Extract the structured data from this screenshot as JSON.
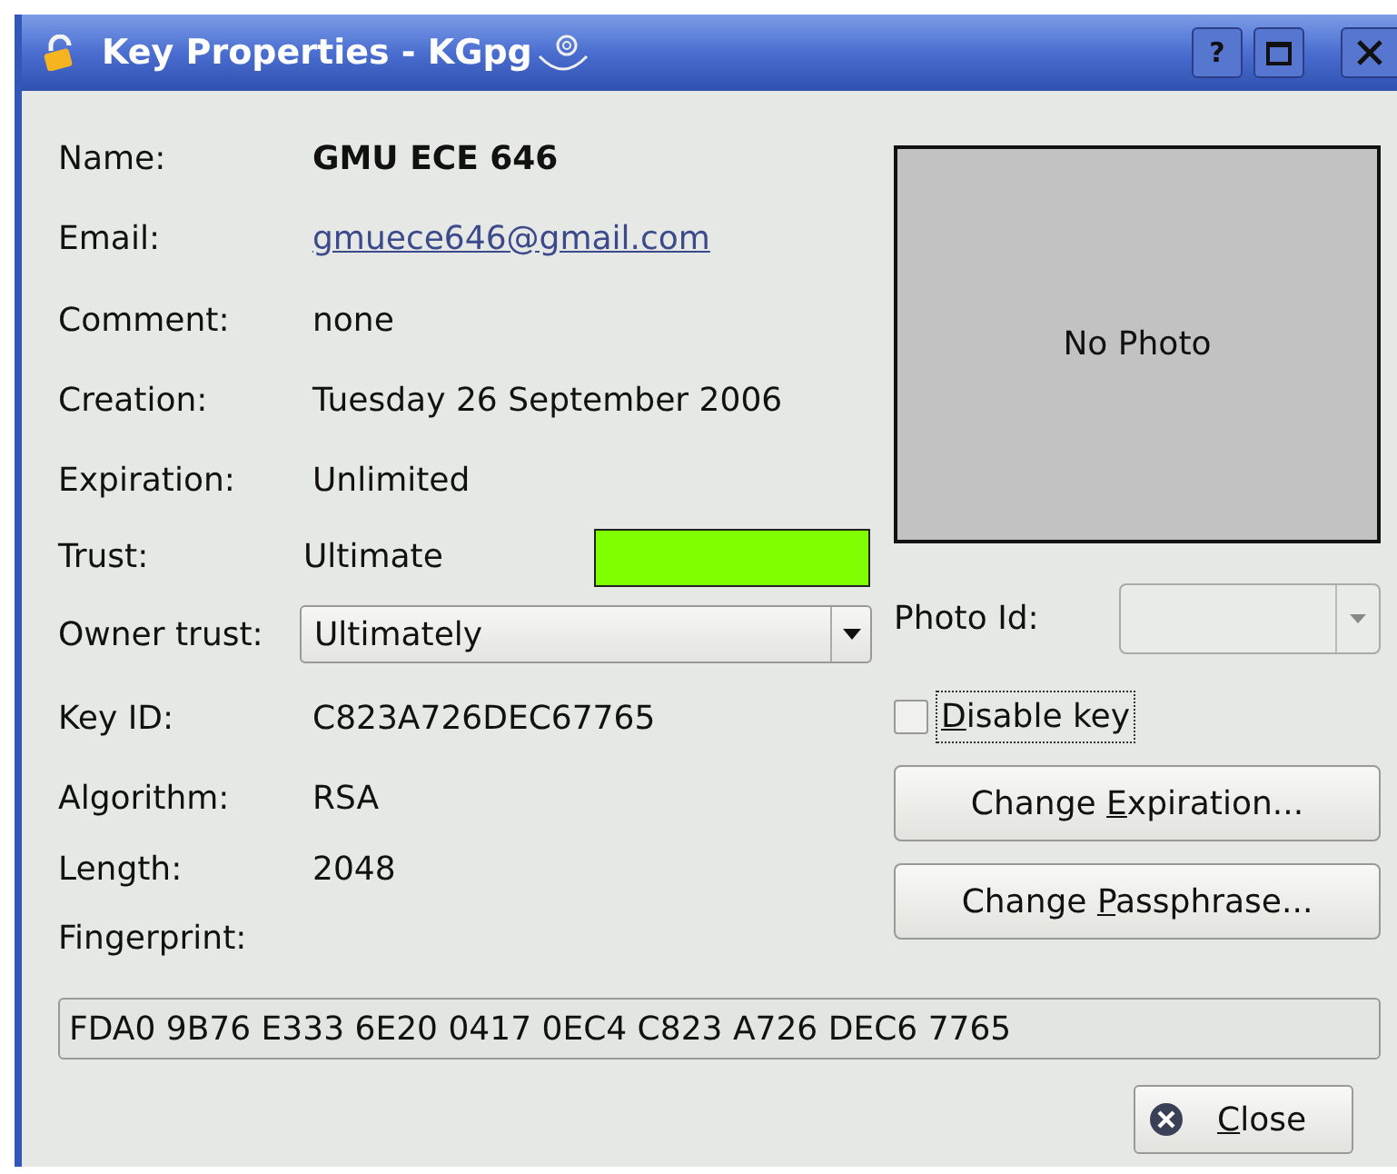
{
  "window": {
    "title": "Key Properties - KGpg",
    "buttons": [
      "?"
    ]
  },
  "fields": [
    {
      "kind": "bold",
      "label": "Name:",
      "value": "GMU ECE 646"
    },
    {
      "kind": "link",
      "label": "Email:",
      "value": "gmuece646@gmail.com"
    },
    {
      "kind": "text",
      "label": "Comment:",
      "value": "none"
    },
    {
      "kind": "text",
      "label": "Creation:",
      "value": "Tuesday 26 September 2006"
    },
    {
      "kind": "text",
      "label": "Expiration:",
      "value": "Unlimited"
    },
    {
      "kind": "trust",
      "label": "Trust:",
      "value": "Ultimate",
      "color": "#80ff00"
    },
    {
      "kind": "select",
      "label": "Owner trust:",
      "value": "Ultimately"
    },
    {
      "kind": "text",
      "label": "Key ID:",
      "value": "C823A726DEC67765"
    },
    {
      "kind": "text",
      "label": "Algorithm:",
      "value": "RSA"
    },
    {
      "kind": "text",
      "label": "Length:",
      "value": "2048"
    },
    {
      "kind": "heading",
      "label": "Fingerprint:"
    }
  ],
  "photo": {
    "text": "No Photo"
  },
  "photo_id": {
    "label": "Photo Id:"
  },
  "disable_key": {
    "label_parts": {
      "key": "D",
      "after": "isable key"
    },
    "checked": false
  },
  "actions": [
    {
      "label_parts": {
        "before": "Change ",
        "key": "E",
        "after": "xpiration..."
      }
    },
    {
      "label_parts": {
        "before": "Change ",
        "key": "P",
        "after": "assphrase..."
      }
    }
  ],
  "fingerprint": "FDA0 9B76 E333 6E20 0417 0EC4 C823 A726 DEC6 7765",
  "close_button": {
    "label_parts": {
      "key": "C",
      "after": "lose"
    }
  }
}
